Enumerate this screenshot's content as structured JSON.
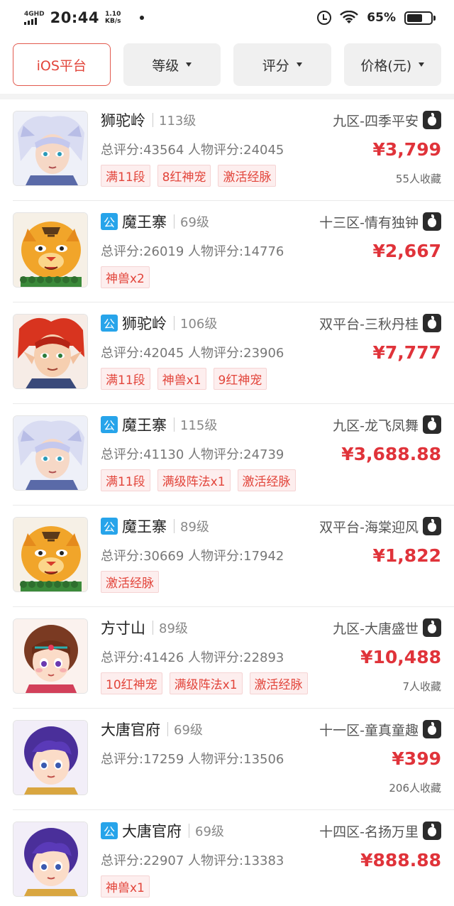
{
  "status": {
    "network": "4GHD",
    "time": "20:44",
    "speed_value": "1.10",
    "speed_unit": "KB/s",
    "battery": "65%"
  },
  "filters": [
    {
      "label": "iOS平台",
      "active": true
    },
    {
      "label": "等级",
      "active": false
    },
    {
      "label": "评分",
      "active": false
    },
    {
      "label": "价格(元)",
      "active": false
    }
  ],
  "listings": [
    {
      "public": false,
      "school": "狮驼岭",
      "level": "113级",
      "server": "九区-四季平安",
      "score": "总评分:43564 人物评分:24045",
      "price": "¥3,799",
      "tags": [
        "满11段",
        "8红神宠",
        "激活经脉"
      ],
      "favorites": "55人收藏",
      "avatar": "white-haired-avatar"
    },
    {
      "public": true,
      "school": "魔王寨",
      "level": "69级",
      "server": "十三区-情有独钟",
      "score": "总评分:26019 人物评分:14776",
      "price": "¥2,667",
      "tags": [
        "神兽x2"
      ],
      "favorites": "",
      "avatar": "tiger-avatar"
    },
    {
      "public": true,
      "school": "狮驼岭",
      "level": "106级",
      "server": "双平台-三秋丹桂",
      "score": "总评分:42045 人物评分:23906",
      "price": "¥7,777",
      "tags": [
        "满11段",
        "神兽x1",
        "9红神宠"
      ],
      "favorites": "",
      "avatar": "red-haired-avatar"
    },
    {
      "public": true,
      "school": "魔王寨",
      "level": "115级",
      "server": "九区-龙飞凤舞",
      "score": "总评分:41130 人物评分:24739",
      "price": "¥3,688.88",
      "tags": [
        "满11段",
        "满级阵法x1",
        "激活经脉"
      ],
      "favorites": "",
      "avatar": "white-haired-avatar"
    },
    {
      "public": true,
      "school": "魔王寨",
      "level": "89级",
      "server": "双平台-海棠迎风",
      "score": "总评分:30669 人物评分:17942",
      "price": "¥1,822",
      "tags": [
        "激活经脉"
      ],
      "favorites": "",
      "avatar": "tiger-avatar"
    },
    {
      "public": false,
      "school": "方寸山",
      "level": "89级",
      "server": "九区-大唐盛世",
      "score": "总评分:41426 人物评分:22893",
      "price": "¥10,488",
      "tags": [
        "10红神宠",
        "满级阵法x1",
        "激活经脉"
      ],
      "favorites": "7人收藏",
      "avatar": "girl-avatar"
    },
    {
      "public": false,
      "school": "大唐官府",
      "level": "69级",
      "server": "十一区-童真童趣",
      "score": "总评分:17259 人物评分:13506",
      "price": "¥399",
      "tags": [],
      "favorites": "206人收藏",
      "avatar": "purple-haired-avatar"
    },
    {
      "public": true,
      "school": "大唐官府",
      "level": "69级",
      "server": "十四区-名扬万里",
      "score": "总评分:22907 人物评分:13383",
      "price": "¥888.88",
      "tags": [
        "神兽x1"
      ],
      "favorites": "",
      "avatar": "purple-haired-avatar"
    }
  ],
  "public_badge": "公",
  "colors": {
    "accent": "#e2443a",
    "price": "#e0333a",
    "badge": "#27a4ea"
  }
}
